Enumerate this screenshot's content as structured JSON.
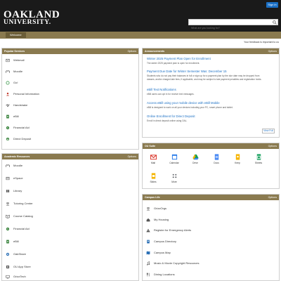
{
  "header": {
    "logo_line1": "OAKLAND",
    "logo_line2": "UNIVERSITY.",
    "signin_label": "Sign in",
    "search_placeholder": "What are you looking for?"
  },
  "nav": {
    "tabs": [
      {
        "label": "Welcome"
      }
    ]
  },
  "feedback_text": "Your feedback is important to us",
  "popular_services": {
    "title": "Popular Services",
    "options_label": "Options",
    "items": [
      {
        "label": "Webmail"
      },
      {
        "label": "Moodle"
      },
      {
        "label": "Go!"
      },
      {
        "label": "Personal Information"
      },
      {
        "label": "Handshake"
      },
      {
        "label": "eBill"
      },
      {
        "label": "Financial Aid"
      },
      {
        "label": "Direct Deposit"
      }
    ]
  },
  "announcements": {
    "title": "Announcements",
    "options_label": "Options",
    "items": [
      {
        "title": "Winter 2025 Payment Plan Open for Enrollment",
        "body": "The winter 2025 payment plan is open for enrollment."
      },
      {
        "title": "Payment Due Date for Winter Semester Was: December 15",
        "body": "Students who do not pay their balances in full or sign up for a payment plan by the due date may be dropped from",
        "body2": "classes, and/or charged late fees, if applicable, and may be subject to late payment penalties and registration holds."
      },
      {
        "title": "eBill Text Notifications",
        "body": "eBill users can opt in for receive text messages."
      },
      {
        "title": "Access eBill using your mobile device with eBill Mobile",
        "body": "eBill is designed to work on all your devices including your PC, smart phone and tablet."
      },
      {
        "title": "Online Enrollment for Direct Deposit",
        "body": "Enroll in direct deposit online using OAL."
      }
    ],
    "view_all_label": "View Full"
  },
  "academic_resources": {
    "title": "Academic Resources",
    "options_label": "Options",
    "items": [
      {
        "label": "Moodle"
      },
      {
        "label": "eSpace"
      },
      {
        "label": "Library"
      },
      {
        "label": "Tutoring Center"
      },
      {
        "label": "Course Catalog"
      },
      {
        "label": "Financial Aid"
      },
      {
        "label": "eBill"
      },
      {
        "label": "OakShare"
      },
      {
        "label": "OU App Store"
      },
      {
        "label": "GrizzTech"
      }
    ]
  },
  "ou_gsuite": {
    "title": "OU Suite",
    "options_label": "Options",
    "apps": [
      {
        "label": "Mail",
        "icon": "gmail-icon",
        "color": "#d93025"
      },
      {
        "label": "Calendar",
        "icon": "calendar-icon",
        "color": "#1a73e8"
      },
      {
        "label": "Drive",
        "icon": "drive-icon",
        "color": "#0f9d58"
      },
      {
        "label": "Docs",
        "icon": "docs-icon",
        "color": "#4285f4"
      },
      {
        "label": "Keep",
        "icon": "keep-icon",
        "color": "#f6b400"
      },
      {
        "label": "Sheets",
        "icon": "sheets-icon",
        "color": "#0f9d58"
      },
      {
        "label": "Slides",
        "icon": "slides-icon",
        "color": "#f4b400"
      },
      {
        "label": "More",
        "icon": "more-icon",
        "color": "#5f6368"
      }
    ]
  },
  "campus_life": {
    "title": "Campus Life",
    "options_label": "Options",
    "items": [
      {
        "label": "GrizzOrgs"
      },
      {
        "label": "My Housing"
      },
      {
        "label": "Register for Emergency Alerts"
      },
      {
        "label": "Campus Directory"
      },
      {
        "label": "Campus Map"
      },
      {
        "label": "Music & Movie Copyright Resources"
      },
      {
        "label": "Dining Locations"
      }
    ]
  },
  "colors": {
    "brand_black": "#1a1a1a",
    "brand_gold": "#8a7a4f",
    "link_blue": "#1a6fc4"
  }
}
